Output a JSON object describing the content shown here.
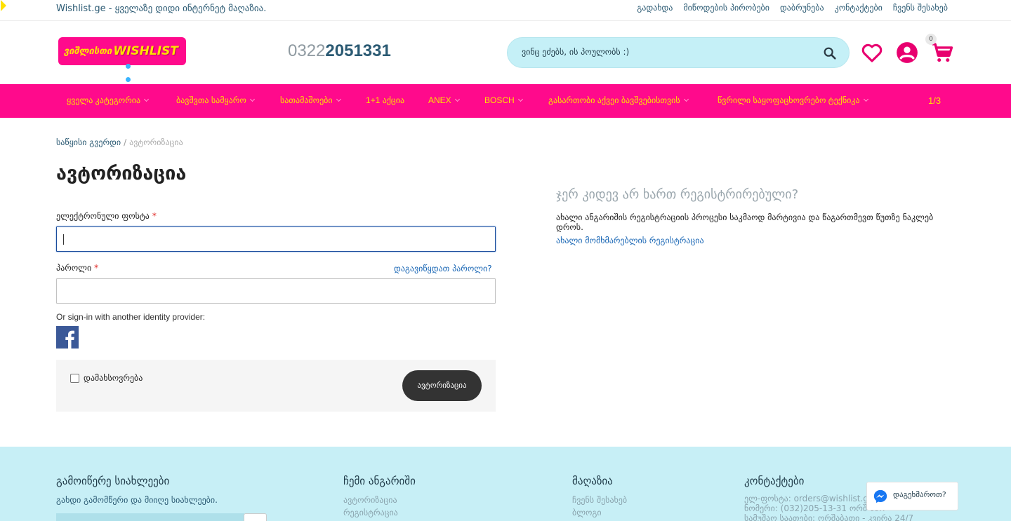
{
  "topbar": {
    "tagline": "Wishlist.ge - ყველაზე დიდი ინტერნეტ მაღაზია.",
    "links": [
      "გადახდა",
      "მიწოდების პირობები",
      "დაბრუნება",
      "კონტაქტები",
      "ჩვენს შესახებ"
    ]
  },
  "header": {
    "logo_text_1": "ვიშლისთი",
    "logo_text_2": "WISHLIST",
    "phone_prefix": "0322",
    "phone_main": "051331",
    "phone_mid": "2",
    "search_placeholder": "ვინც ეძებს, ის პოულობს :)",
    "cart_count": "0",
    "icons": [
      "search-icon",
      "heart-icon",
      "account-icon",
      "cart-icon"
    ]
  },
  "nav": {
    "items": [
      {
        "label": "ყველა კატეგორია",
        "dropdown": true
      },
      {
        "label": "ბავშვთა სამყარო",
        "dropdown": true
      },
      {
        "label": "სათამაშოები",
        "dropdown": true
      },
      {
        "label": "1+1 აქცია",
        "dropdown": false
      },
      {
        "label": "ANEX",
        "dropdown": true
      },
      {
        "label": "BOSCH",
        "dropdown": true
      },
      {
        "label": "გასართობი აქვეი ბავშვებისთვის",
        "dropdown": true
      },
      {
        "label": "წვრილი საყოფაცხოვრებო ტექნიკა",
        "dropdown": true
      }
    ],
    "pager": "1/3"
  },
  "breadcrumb": {
    "home": "საწყისი გვერდი",
    "separator": "/",
    "current": "ავტორიზაცია"
  },
  "page_title": "ავტორიზაცია",
  "login": {
    "email_label": "ელექტრონული ფოსტა",
    "password_label": "პაროლი",
    "required_mark": "*",
    "email_value": "",
    "password_value": "",
    "forgot_link": "დაგავიწყდათ პაროლი?",
    "idp_text": "Or sign-in with another identity provider:",
    "remember_label": "დამახსოვრება",
    "remember_checked": false,
    "submit_label": "ავტორიზაცია"
  },
  "register": {
    "title": "ჯერ კიდევ არ ხართ რეგისტრირებული?",
    "text": "ახალი ანგარიშის რეგისტრაციის პროცესი საკმაოდ მარტივია და წაგართმევთ წუთზე ნაკლებ დროს.",
    "link": "ახალი მომხმარებლის რეგისტრაცია"
  },
  "footer": {
    "newsletter_title": "გამოიწერე სიახლეები",
    "newsletter_text": "გახდი გამომწერი და მიიღე სიახლეები.",
    "account_title": "ჩემი ანგარიში",
    "account_links": [
      "ავტორიზაცია",
      "რეგისტრაცია"
    ],
    "shop_title": "მაღაზია",
    "shop_links": [
      "ჩვენს შესახებ",
      "ბლოგი"
    ],
    "contacts_title": "კონტაქტები",
    "contacts_lines": [
      "ელ-ფოსტა: orders@wishlist.ge",
      "ნომერი: (032)205-13-31 ორშ-პარ",
      "სამუშაო საათები: ორშაბათი - კვირა 24/7"
    ]
  },
  "messenger": {
    "label": "დაგეხმაროთ?"
  },
  "colors": {
    "brand_pink": "#ff0a8c",
    "nav_text_yellow": "#ffe100",
    "search_bg": "#c5f0f7",
    "footer_bg": "#c7eff6",
    "dark_button": "#333333",
    "link_blue": "#1a67b5",
    "icon_pink": "#e8006f"
  }
}
